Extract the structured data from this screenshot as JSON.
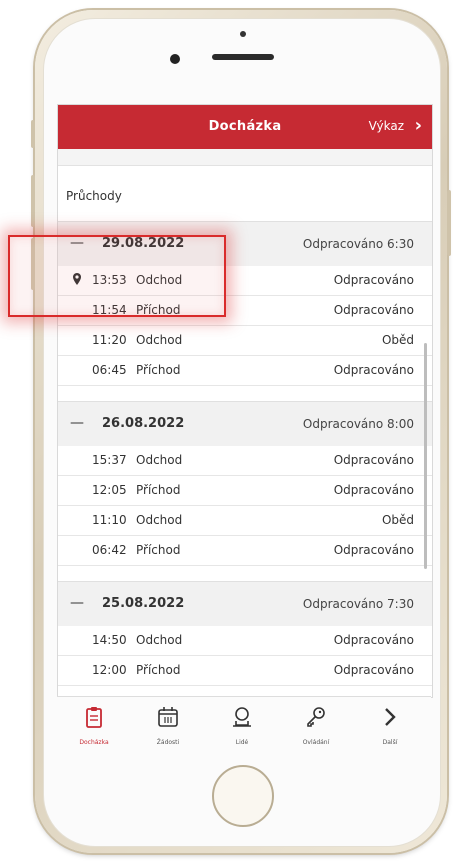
{
  "header": {
    "title": "Docházka",
    "link_label": "Výkaz",
    "link_chevron": "›"
  },
  "section_label": "Průchody",
  "groups": [
    {
      "collapse": "—",
      "date": "29.08.2022",
      "worked": "Odpracováno 6:30",
      "rows": [
        {
          "time": "13:53",
          "type": "Odchod",
          "status": "Odpracováno",
          "icon": "location-pin-icon"
        },
        {
          "time": "11:54",
          "type": "Příchod",
          "status": "Odpracováno"
        },
        {
          "time": "11:20",
          "type": "Odchod",
          "status": "Oběd"
        },
        {
          "time": "06:45",
          "type": "Příchod",
          "status": "Odpracováno"
        }
      ]
    },
    {
      "collapse": "—",
      "date": "26.08.2022",
      "worked": "Odpracováno 8:00",
      "rows": [
        {
          "time": "15:37",
          "type": "Odchod",
          "status": "Odpracováno"
        },
        {
          "time": "12:05",
          "type": "Příchod",
          "status": "Odpracováno"
        },
        {
          "time": "11:10",
          "type": "Odchod",
          "status": "Oběd"
        },
        {
          "time": "06:42",
          "type": "Příchod",
          "status": "Odpracováno"
        }
      ]
    },
    {
      "collapse": "—",
      "date": "25.08.2022",
      "worked": "Odpracováno 7:30",
      "rows": [
        {
          "time": "14:50",
          "type": "Odchod",
          "status": "Odpracováno"
        },
        {
          "time": "12:00",
          "type": "Příchod",
          "status": "Odpracováno"
        }
      ]
    }
  ],
  "tabs": [
    {
      "label": "Docházka",
      "icon": "clipboard-icon",
      "active": true
    },
    {
      "label": "Žádosti",
      "icon": "calendar-icon",
      "active": false
    },
    {
      "label": "Lidé",
      "icon": "person-icon",
      "active": false
    },
    {
      "label": "Ovládání",
      "icon": "key-icon",
      "active": false
    },
    {
      "label": "Další",
      "icon": "chevron-right-icon",
      "active": false
    }
  ],
  "colors": {
    "accent": "#c62a33",
    "highlight": "#d92b2b"
  }
}
